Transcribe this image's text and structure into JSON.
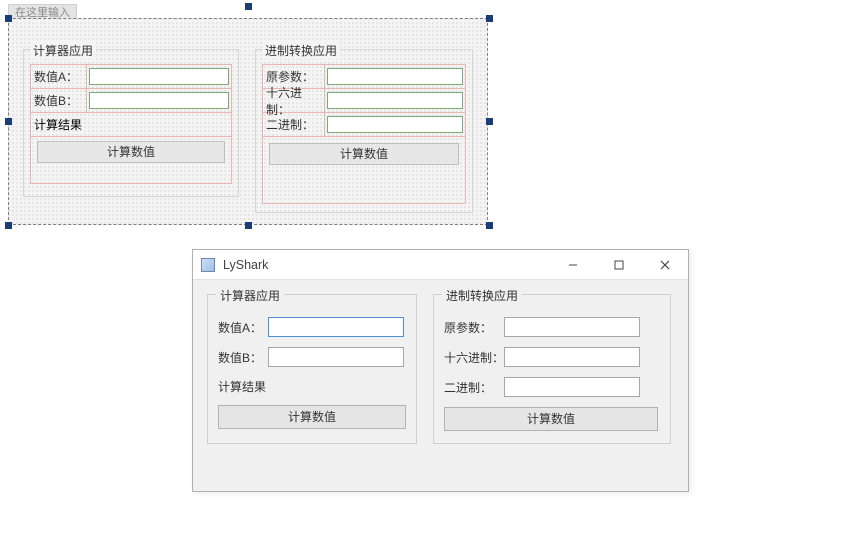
{
  "designer": {
    "title_hint": "在这里输入",
    "calc_group": {
      "title": "计算器应用",
      "value_a_label": "数值A：",
      "value_b_label": "数值B：",
      "result_label": "计算结果",
      "button": "计算数值"
    },
    "conv_group": {
      "title": "进制转换应用",
      "param_label": "原参数：",
      "hex_label": "十六进制：",
      "bin_label": "二进制：",
      "button": "计算数值"
    }
  },
  "runtime": {
    "window_title": "LyShark",
    "calc_group": {
      "title": "计算器应用",
      "value_a_label": "数值A：",
      "value_a_value": "",
      "value_b_label": "数值B：",
      "value_b_value": "",
      "result_label": "计算结果",
      "button": "计算数值"
    },
    "conv_group": {
      "title": "进制转换应用",
      "param_label": "原参数：",
      "param_value": "",
      "hex_label": "十六进制：",
      "hex_value": "",
      "bin_label": "二进制：",
      "bin_value": "",
      "button": "计算数值"
    }
  }
}
